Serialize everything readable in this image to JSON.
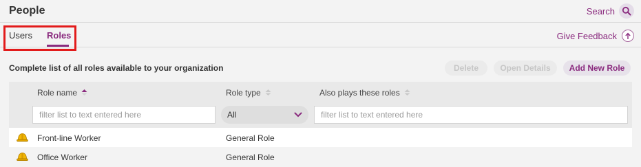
{
  "header": {
    "title": "People",
    "search_label": "Search",
    "search_icon": "search-icon"
  },
  "tabs": [
    {
      "label": "Users",
      "active": false
    },
    {
      "label": "Roles",
      "active": true
    }
  ],
  "feedback": {
    "label": "Give Feedback",
    "icon": "upload-arrow-icon"
  },
  "toolbar": {
    "subtitle": "Complete list of all roles available to your organization",
    "delete_label": "Delete",
    "open_details_label": "Open Details",
    "add_new_role_label": "Add New Role"
  },
  "table": {
    "columns": [
      {
        "label": "Role name",
        "sort": "ascending"
      },
      {
        "label": "Role type",
        "sort": "none"
      },
      {
        "label": "Also plays these roles",
        "sort": "none"
      }
    ],
    "filters": {
      "name_placeholder": "filter list to text entered here",
      "type_value": "All",
      "also_placeholder": "filter list to text entered here"
    },
    "rows": [
      {
        "icon": "hard-hat-icon",
        "name": "Front-line Worker",
        "type": "General Role",
        "also": ""
      },
      {
        "icon": "hard-hat-icon",
        "name": "Office Worker",
        "type": "General Role",
        "also": ""
      }
    ]
  },
  "colors": {
    "accent": "#8a2a7e",
    "highlight": "#e21b1b",
    "icon_yellow": "#f2b705"
  }
}
